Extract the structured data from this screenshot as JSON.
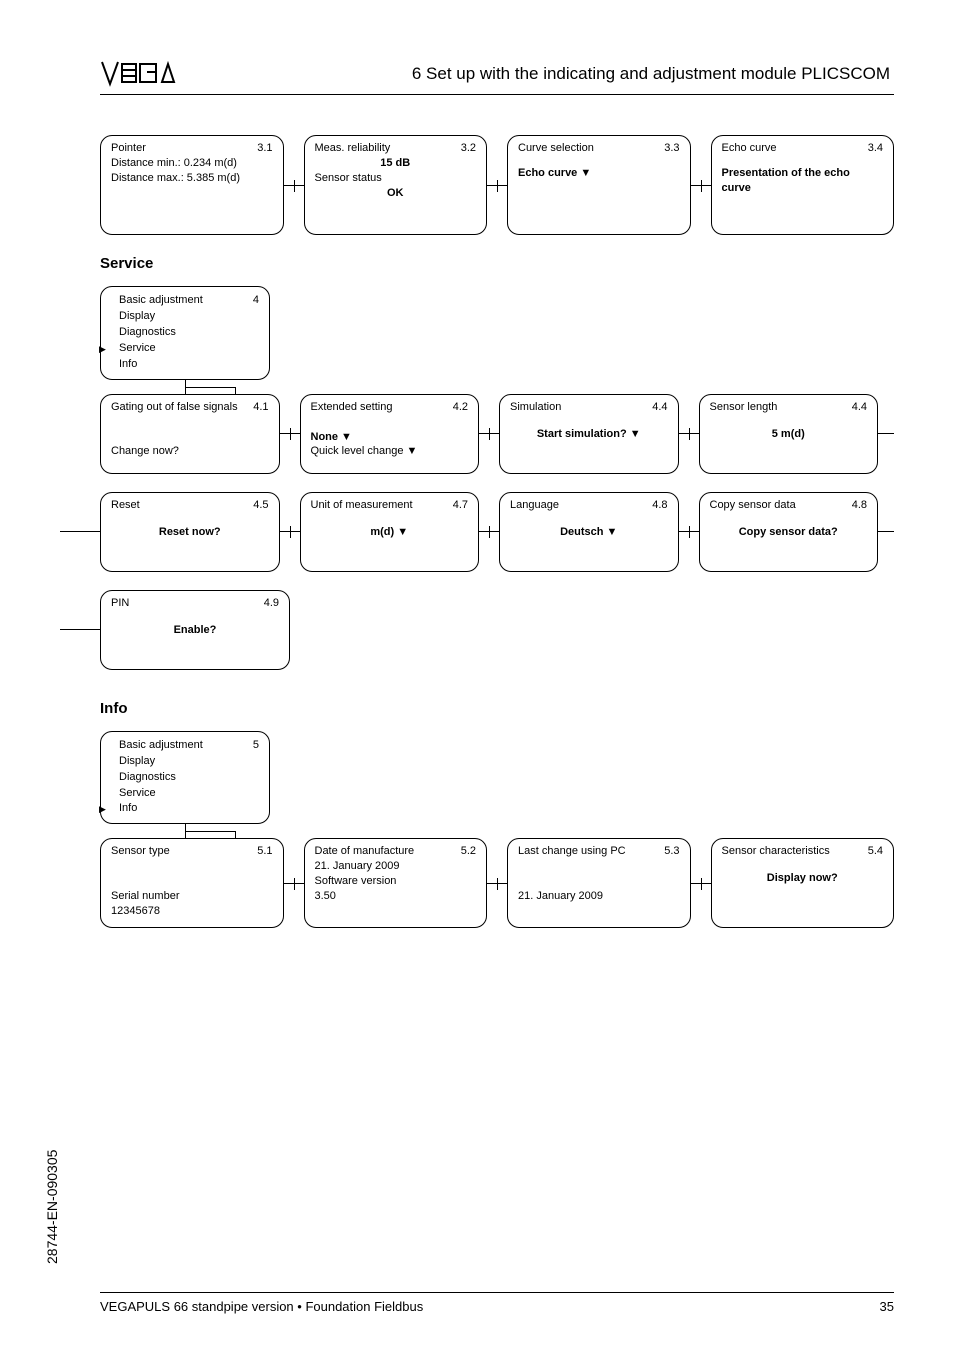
{
  "header": {
    "logo_text": "VEGA",
    "title": "6  Set up with the indicating and adjustment module PLICSCOM"
  },
  "row_top": [
    {
      "title": "Pointer",
      "num": "3.1",
      "lines": [
        "",
        "Distance min.: 0.234 m(d)",
        "Distance max.: 5.385 m(d)"
      ],
      "bold_lines": []
    },
    {
      "title": "Meas. reliability",
      "num": "3.2",
      "lines_mixed": [
        {
          "t": "15 dB",
          "b": true,
          "c": true
        },
        {
          "t": "Sensor status",
          "b": false,
          "c": false
        },
        {
          "t": "OK",
          "b": true,
          "c": true
        }
      ]
    },
    {
      "title": "Curve selection",
      "num": "3.3",
      "single_bold": "Echo curve ▼"
    },
    {
      "title": "Echo curve",
      "num": "3.4",
      "multi_bold": [
        "Presentation of the echo",
        "curve"
      ]
    }
  ],
  "section_service": "Service",
  "menu_service": {
    "num": "4",
    "items": [
      "Basic adjustment",
      "Display",
      "Diagnostics",
      "Service",
      "Info"
    ],
    "selected": 3
  },
  "row_service_1": [
    {
      "title": "Gating out of false signals",
      "num": "4.1",
      "lines": [
        "",
        "",
        "Change now?"
      ]
    },
    {
      "title": "Extended setting",
      "num": "4.2",
      "lines_mixed": [
        {
          "t": "",
          "b": false
        },
        {
          "t": "None ▼",
          "b": true
        },
        {
          "t": "Quick level change ▼",
          "b": false
        }
      ]
    },
    {
      "title": "Simulation",
      "num": "4.4",
      "single_bold_mid": "Start simulation? ▼"
    },
    {
      "title": "Sensor length",
      "num": "4.4",
      "single_bold_mid": "5 m(d)"
    }
  ],
  "row_service_2": [
    {
      "title": "Reset",
      "num": "4.5",
      "single_bold_mid": "Reset now?"
    },
    {
      "title": "Unit of measurement",
      "num": "4.7",
      "single_bold_mid": "m(d) ▼"
    },
    {
      "title": "Language",
      "num": "4.8",
      "single_bold_mid": "Deutsch ▼"
    },
    {
      "title": "Copy sensor data",
      "num": "4.8",
      "single_bold_mid": "Copy sensor data?"
    }
  ],
  "row_service_3": [
    {
      "title": "PIN",
      "num": "4.9",
      "single_bold_mid": "Enable?"
    }
  ],
  "section_info": "Info",
  "menu_info": {
    "num": "5",
    "items": [
      "Basic adjustment",
      "Display",
      "Diagnostics",
      "Service",
      "Info"
    ],
    "selected": 4
  },
  "row_info": [
    {
      "title": "Sensor type",
      "num": "5.1",
      "lines": [
        "",
        "",
        "Serial number",
        "12345678"
      ]
    },
    {
      "title": "Date of manufacture",
      "num": "5.2",
      "lines": [
        "21. January 2009",
        "Software version",
        "3.50"
      ]
    },
    {
      "title": "Last change using PC",
      "num": "5.3",
      "lines": [
        "",
        "",
        "21. January 2009"
      ]
    },
    {
      "title": "Sensor characteristics",
      "num": "5.4",
      "single_bold_mid": "Display now?"
    }
  ],
  "side_doc": "28744-EN-090305",
  "footer": {
    "left": "VEGAPULS 66 standpipe version • Foundation Fieldbus",
    "right": "35"
  }
}
